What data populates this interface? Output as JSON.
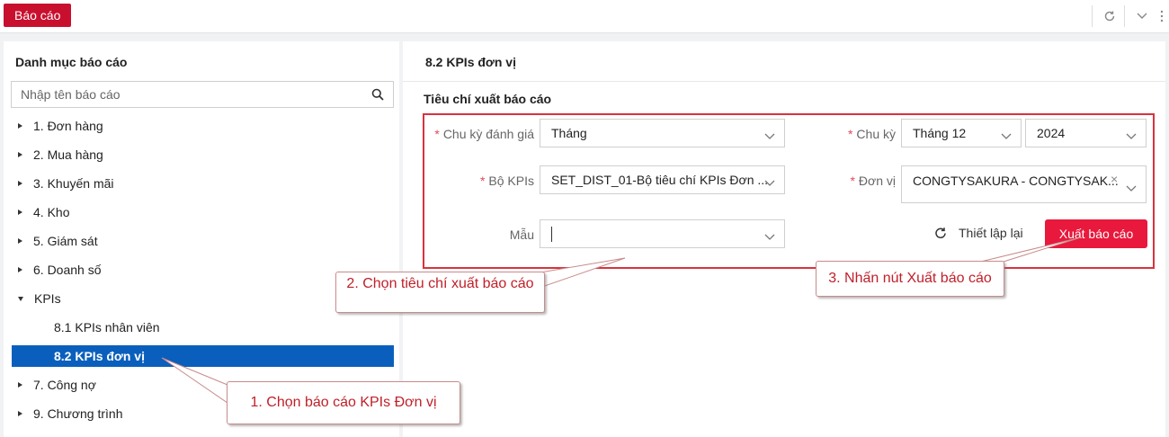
{
  "topbar": {
    "tab_label": "Báo cáo"
  },
  "sidebar": {
    "title": "Danh mục báo cáo",
    "search_placeholder": "Nhập tên báo cáo",
    "items": [
      {
        "label": "1. Đơn hàng"
      },
      {
        "label": "2. Mua hàng"
      },
      {
        "label": "3. Khuyến mãi"
      },
      {
        "label": "4. Kho"
      },
      {
        "label": "5. Giám sát"
      },
      {
        "label": "6. Doanh số"
      },
      {
        "label": "KPIs"
      },
      {
        "label": "8.1 KPIs nhân viên"
      },
      {
        "label": "8.2 KPIs đơn vị"
      },
      {
        "label": "7. Công nợ"
      },
      {
        "label": "9. Chương trình"
      }
    ]
  },
  "main": {
    "report_title": "8.2 KPIs đơn vị",
    "section_title": "Tiêu chí xuất báo cáo",
    "fields": {
      "cycle_eval_label": "Chu kỳ đánh giá",
      "cycle_eval_value": "Tháng",
      "cycle_label": "Chu kỳ",
      "cycle_month": "Tháng 12",
      "cycle_year": "2024",
      "kpi_set_label": "Bộ KPIs",
      "kpi_set_value": "SET_DIST_01-Bộ tiêu chí KPIs Đơn ...",
      "unit_label": "Đơn vị",
      "unit_value": "CONGTYSAKURA - CONGTYSAK...",
      "template_label": "Mẫu",
      "template_value": ""
    },
    "reset_label": "Thiết lập lại",
    "export_label": "Xuất báo cáo"
  },
  "callouts": {
    "step1": "1. Chọn báo cáo KPIs Đơn vị",
    "step2": "2. Chọn tiêu chí xuất báo cáo",
    "step3": "3. Nhấn nút Xuất báo cáo"
  },
  "colors": {
    "brand": "#c8102e",
    "selected": "#0a5fbd",
    "button": "#e8193c",
    "highlight": "#d8333d"
  }
}
